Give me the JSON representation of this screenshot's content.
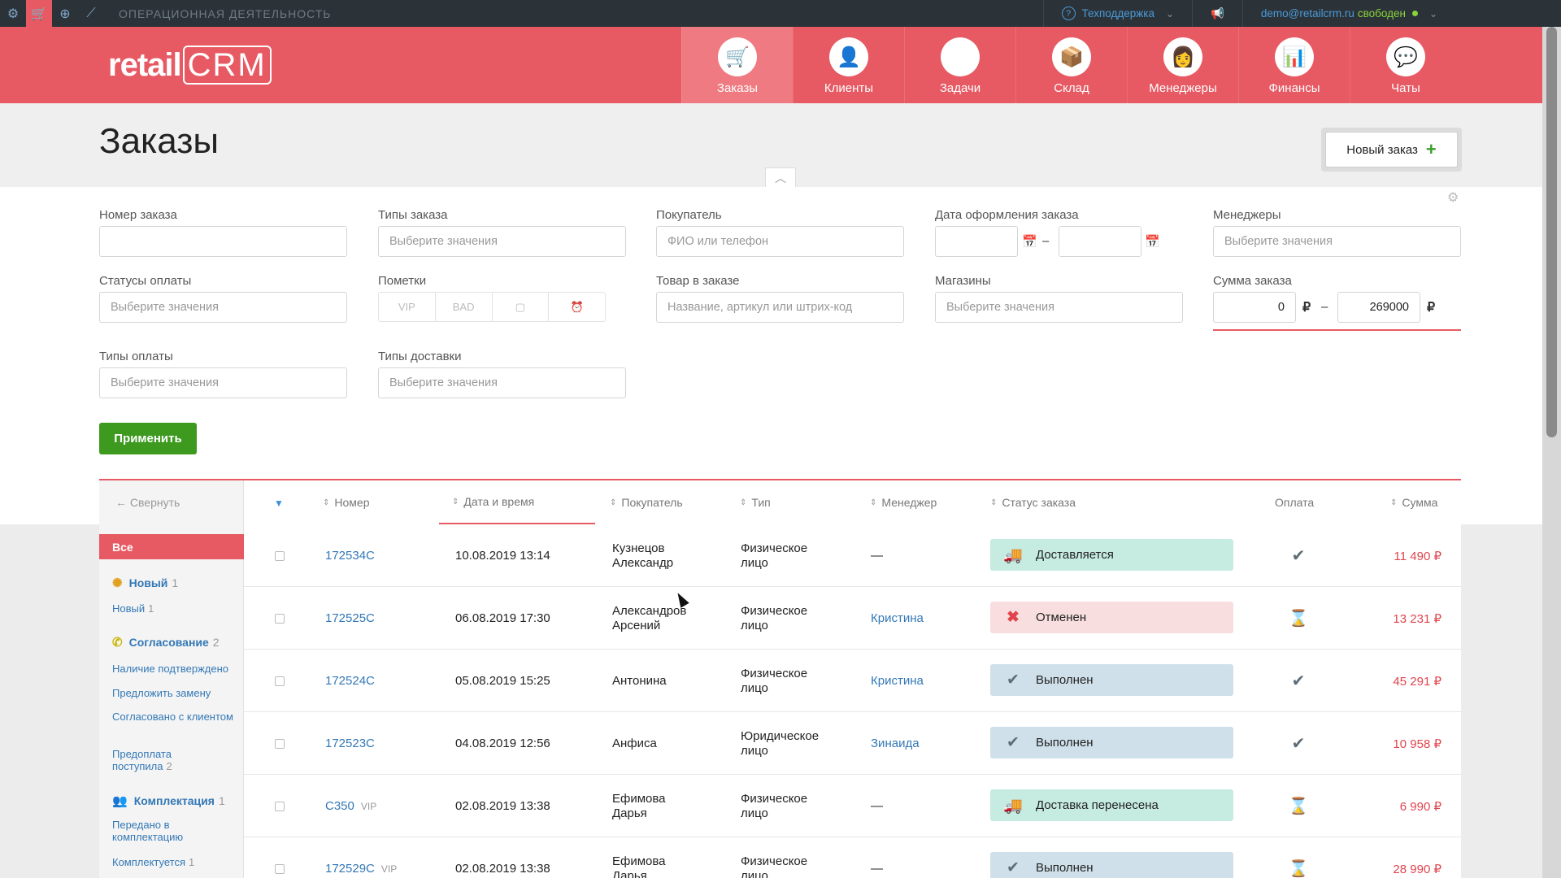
{
  "topbar": {
    "section_title": "ОПЕРАЦИОННАЯ ДЕЯТЕЛЬНОСТЬ",
    "support": "Техподдержка",
    "user_email": "demo@retailcrm.ru",
    "user_status": "свободен"
  },
  "logo": {
    "text_left": "retail",
    "text_right": "CRM"
  },
  "nav": [
    {
      "label": "Заказы",
      "icon": "cart-icon",
      "glyph": "🛒"
    },
    {
      "label": "Клиенты",
      "icon": "client-icon",
      "glyph": "👤"
    },
    {
      "label": "Задачи",
      "icon": "tasks-icon",
      "glyph": "☰"
    },
    {
      "label": "Склад",
      "icon": "warehouse-icon",
      "glyph": "📦"
    },
    {
      "label": "Менеджеры",
      "icon": "managers-icon",
      "glyph": "👩"
    },
    {
      "label": "Финансы",
      "icon": "finance-icon",
      "glyph": "📊"
    },
    {
      "label": "Чаты",
      "icon": "chat-icon",
      "glyph": "💬"
    }
  ],
  "page": {
    "title": "Заказы",
    "new_order": "Новый заказ"
  },
  "filters": {
    "order_number": {
      "label": "Номер заказа",
      "placeholder": ""
    },
    "order_types": {
      "label": "Типы заказа",
      "placeholder": "Выберите значения"
    },
    "customer": {
      "label": "Покупатель",
      "placeholder": "ФИО или телефон"
    },
    "order_date": {
      "label": "Дата оформления заказа"
    },
    "managers": {
      "label": "Менеджеры",
      "placeholder": "Выберите значения"
    },
    "payment_statuses": {
      "label": "Статусы оплаты",
      "placeholder": "Выберите значения"
    },
    "marks": {
      "label": "Пометки",
      "vip": "VIP",
      "bad": "BAD"
    },
    "product": {
      "label": "Товар в заказе",
      "placeholder": "Название, артикул или штрих-код"
    },
    "shops": {
      "label": "Магазины",
      "placeholder": "Выберите значения"
    },
    "order_sum": {
      "label": "Сумма заказа",
      "from": "0",
      "to": "269000",
      "currency": "₽"
    },
    "payment_types": {
      "label": "Типы оплаты",
      "placeholder": "Выберите значения"
    },
    "delivery_types": {
      "label": "Типы доставки",
      "placeholder": "Выберите значения"
    },
    "apply": "Применить"
  },
  "table": {
    "collapse": "← Свернуть",
    "columns": {
      "number": "Номер",
      "datetime": "Дата и время",
      "customer": "Покупатель",
      "type": "Тип",
      "manager": "Менеджер",
      "status": "Статус заказа",
      "payment": "Оплата",
      "sum": "Сумма"
    },
    "rows": [
      {
        "number": "172534C",
        "vip": "",
        "datetime": "10.08.2019 13:14",
        "customer": "Кузнецов Александр",
        "type": "Физическое лицо",
        "manager": "—",
        "status": "Доставляется",
        "status_kind": "delivering",
        "payment": "paid",
        "sum": "11 490 ₽"
      },
      {
        "number": "172525C",
        "vip": "",
        "datetime": "06.08.2019 17:30",
        "customer": "Александров Арсений",
        "type": "Физическое лицо",
        "manager": "Кристина",
        "status": "Отменен",
        "status_kind": "cancelled",
        "payment": "pending",
        "sum": "13 231 ₽"
      },
      {
        "number": "172524C",
        "vip": "",
        "datetime": "05.08.2019 15:25",
        "customer": "Антонина",
        "type": "Физическое лицо",
        "manager": "Кристина",
        "status": "Выполнен",
        "status_kind": "done",
        "payment": "partial",
        "sum": "45 291 ₽"
      },
      {
        "number": "172523C",
        "vip": "",
        "datetime": "04.08.2019 12:56",
        "customer": "Анфиса",
        "type": "Юридическое лицо",
        "manager": "Зинаида",
        "status": "Выполнен",
        "status_kind": "done",
        "payment": "paid",
        "sum": "10 958 ₽"
      },
      {
        "number": "C350",
        "vip": "VIP",
        "datetime": "02.08.2019 13:38",
        "customer": "Ефимова Дарья",
        "type": "Физическое лицо",
        "manager": "—",
        "status": "Доставка перенесена",
        "status_kind": "delivering",
        "payment": "pending",
        "sum": "6 990 ₽"
      },
      {
        "number": "172529C",
        "vip": "VIP",
        "datetime": "02.08.2019 13:38",
        "customer": "Ефимова Дарья",
        "type": "Физическое лицо",
        "manager": "—",
        "status": "Выполнен",
        "status_kind": "done",
        "payment": "pending",
        "sum": "28 990 ₽"
      }
    ]
  },
  "sidebar": {
    "all": "Все",
    "groups": [
      {
        "label": "Новый",
        "count": "1",
        "icon": "sun-icon",
        "items": [
          {
            "label": "Новый",
            "count": "1"
          }
        ]
      },
      {
        "label": "Согласование",
        "count": "2",
        "icon": "phone-icon",
        "items": [
          {
            "label": "Наличие подтверждено",
            "count": ""
          },
          {
            "label": "Предложить замену",
            "count": ""
          },
          {
            "label": "Согласовано с клиентом",
            "count": ""
          },
          {
            "label": "Предоплата поступила",
            "count": "2"
          }
        ]
      },
      {
        "label": "Комплектация",
        "count": "1",
        "icon": "people-icon",
        "items": [
          {
            "label": "Передано в комплектацию",
            "count": ""
          },
          {
            "label": "Комплектуется",
            "count": "1"
          }
        ]
      }
    ]
  },
  "colors": {
    "brand": "#e75a63",
    "link": "#3378b6",
    "apply": "#3d9a1f"
  }
}
